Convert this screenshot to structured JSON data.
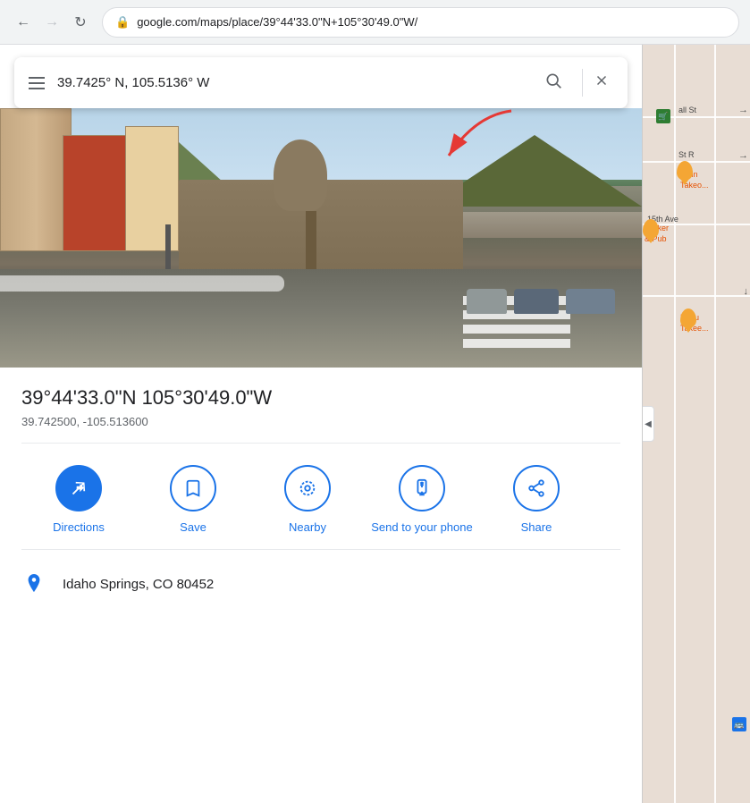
{
  "browser": {
    "url": "google.com/maps/place/39°44'33.0\"N+105°30'49.0\"W/"
  },
  "searchbar": {
    "query": "39.7425° N, 105.5136° W",
    "hamburger_label": "Menu",
    "search_label": "Search",
    "close_label": "Clear"
  },
  "location": {
    "coords_dms": "39°44'33.0\"N 105°30'49.0\"W",
    "coords_decimal": "39.742500, -105.513600",
    "address": "Idaho Springs, CO 80452"
  },
  "actions": [
    {
      "id": "directions",
      "label": "Directions",
      "icon": "directions"
    },
    {
      "id": "save",
      "label": "Save",
      "icon": "bookmark"
    },
    {
      "id": "nearby",
      "label": "Nearby",
      "icon": "nearby"
    },
    {
      "id": "send-to-phone",
      "label": "Send to your phone",
      "icon": "phone"
    },
    {
      "id": "share",
      "label": "Share",
      "icon": "share"
    }
  ],
  "map": {
    "street1": "all St",
    "street2": "St R",
    "street3": "15th Ave",
    "place1": "Main Takeo...",
    "place2": "knocker & Pub",
    "place3": "Beau Takee..."
  }
}
